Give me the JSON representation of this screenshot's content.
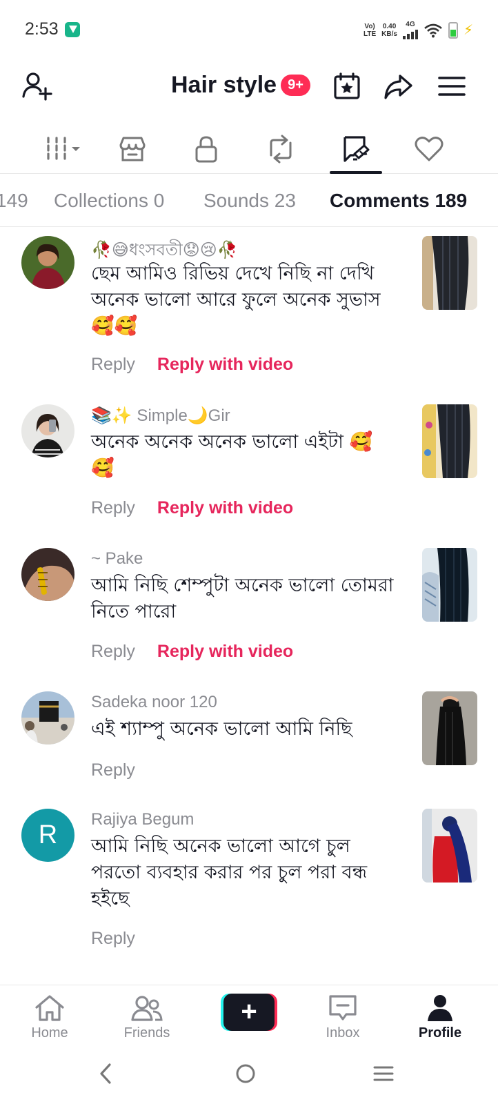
{
  "status_bar": {
    "time": "2:53",
    "volte": "Vo)\nLTE",
    "speed": "0.40\nKB/s",
    "network": "4G"
  },
  "header": {
    "title": "Hair style",
    "badge": "9+"
  },
  "icon_tabs": [
    "grid-filter-icon",
    "shop-icon",
    "lock-icon",
    "repost-icon",
    "comment-history-icon",
    "heart-icon"
  ],
  "text_tabs": [
    {
      "label": "149"
    },
    {
      "label": "Collections 0"
    },
    {
      "label": "Sounds 23"
    },
    {
      "label": "Comments 189"
    }
  ],
  "comments": [
    {
      "username": "🥀😅ধংসবতী😟😢🥀",
      "text": "ছেম আমিও রিভিয় দেখে নিছি না দেখি অনেক ভালো আরে ফুলে অনেক সুভাস 🥰🥰",
      "reply": "Reply",
      "reply_video": "Reply with video"
    },
    {
      "username": "📚✨ Simple🌙Gir",
      "text": "অনেক অনেক অনেক ভালো এইটা 🥰 🥰",
      "reply": "Reply",
      "reply_video": "Reply with video"
    },
    {
      "username": "~ Pake",
      "text": "আমি নিছি শেম্পুটা অনেক ভালো তোমরা নিতে পারো",
      "reply": "Reply",
      "reply_video": "Reply with video"
    },
    {
      "username": "Sadeka noor 120",
      "text": "এই শ্যাম্পু অনেক ভালো আমি নিছি",
      "reply": "Reply"
    },
    {
      "username": "Rajiya Begum",
      "avatar_letter": "R",
      "text": "আমি নিছি অনেক ভালো আগে চুল পরতো ব্যবহার করার পর চুল পরা বন্ধ হইছে",
      "reply": "Reply"
    }
  ],
  "bottom_nav": {
    "home": "Home",
    "friends": "Friends",
    "create": "+",
    "inbox": "Inbox",
    "profile": "Profile"
  },
  "colors": {
    "accent": "#fe2c55",
    "reply_video": "#e6265c",
    "avatar_r": "#139aa6"
  }
}
